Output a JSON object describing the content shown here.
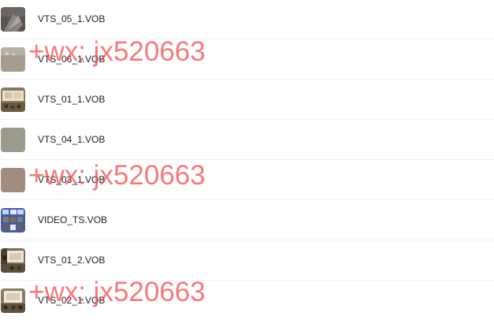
{
  "files": [
    {
      "name": "VTS_05_1.VOB",
      "thumb": "dark-gray-thumbnail"
    },
    {
      "name": "VTS_06_1.VOB",
      "thumb": "beige-gray-thumbnail"
    },
    {
      "name": "VTS_01_1.VOB",
      "thumb": "classroom-thumbnail"
    },
    {
      "name": "VTS_04_1.VOB",
      "thumb": "gray-thumbnail"
    },
    {
      "name": "VTS_03_1.VOB",
      "thumb": "taupe-thumbnail"
    },
    {
      "name": "VIDEO_TS.VOB",
      "thumb": "blue-menu-thumbnail"
    },
    {
      "name": "VTS_01_2.VOB",
      "thumb": "classroom-thumbnail"
    },
    {
      "name": "VTS_02_1.VOB",
      "thumb": "classroom-thumbnail"
    }
  ],
  "watermark": {
    "text": "+wx: jx520663",
    "color": "#f04646"
  }
}
